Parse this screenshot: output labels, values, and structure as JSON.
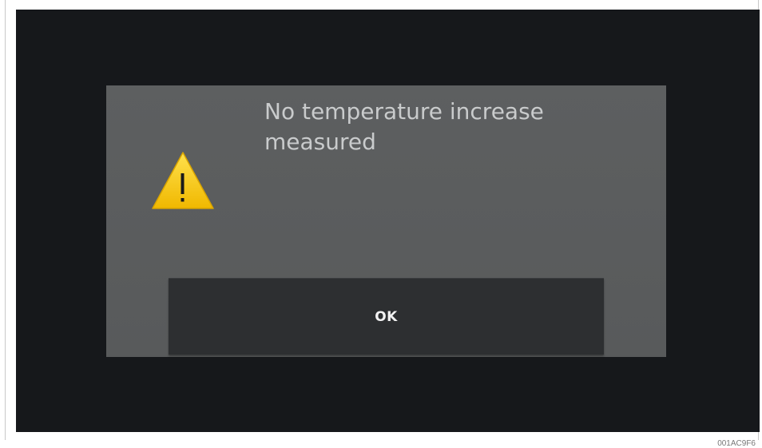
{
  "dialog": {
    "icon": "warning-icon",
    "message": "No temperature increase measured",
    "ok_label": "OK"
  },
  "figure_id": "001AC9F6",
  "colors": {
    "screen_bg": "#16181b",
    "dialog_bg": "#5b5d5e",
    "button_bg": "#2d2f31",
    "warning_fill": "#f5c400",
    "text": "#c9cbcc"
  }
}
